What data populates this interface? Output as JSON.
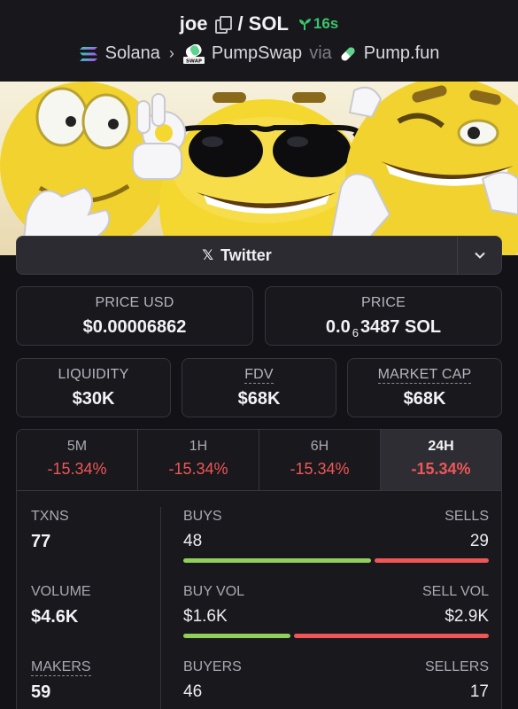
{
  "header": {
    "token": "joe",
    "separator": "/",
    "quote": "SOL",
    "age": "16s",
    "chain": "Solana",
    "dex": "PumpSwap",
    "via": "via",
    "launchpad": "Pump.fun"
  },
  "social": {
    "twitter_label": "Twitter"
  },
  "prices": {
    "usd_label": "PRICE USD",
    "usd_value": "$0.00006862",
    "native_label": "PRICE",
    "native_prefix": "0.0",
    "native_zeros": "6",
    "native_rest": "3487 SOL"
  },
  "metrics": {
    "liquidity_label": "LIQUIDITY",
    "liquidity_value": "$30K",
    "fdv_label": "FDV",
    "fdv_value": "$68K",
    "mcap_label": "MARKET CAP",
    "mcap_value": "$68K"
  },
  "changes": [
    {
      "label": "5M",
      "value": "-15.34%",
      "active": false
    },
    {
      "label": "1H",
      "value": "-15.34%",
      "active": false
    },
    {
      "label": "6H",
      "value": "-15.34%",
      "active": false
    },
    {
      "label": "24H",
      "value": "-15.34%",
      "active": true
    }
  ],
  "stats": {
    "txns": {
      "label": "TXNS",
      "value": "77",
      "left_label": "BUYS",
      "left_value": "48",
      "right_label": "SELLS",
      "right_value": "29",
      "buy_share": 0.623
    },
    "volume": {
      "label": "VOLUME",
      "value": "$4.6K",
      "left_label": "BUY VOL",
      "left_value": "$1.6K",
      "right_label": "SELL VOL",
      "right_value": "$2.9K",
      "buy_share": 0.356
    },
    "makers": {
      "label": "MAKERS",
      "value": "59",
      "left_label": "BUYERS",
      "left_value": "46",
      "right_label": "SELLERS",
      "right_value": "17"
    }
  },
  "colors": {
    "positive": "#8fcf5a",
    "negative": "#ef5656",
    "age": "#3ac46b"
  }
}
